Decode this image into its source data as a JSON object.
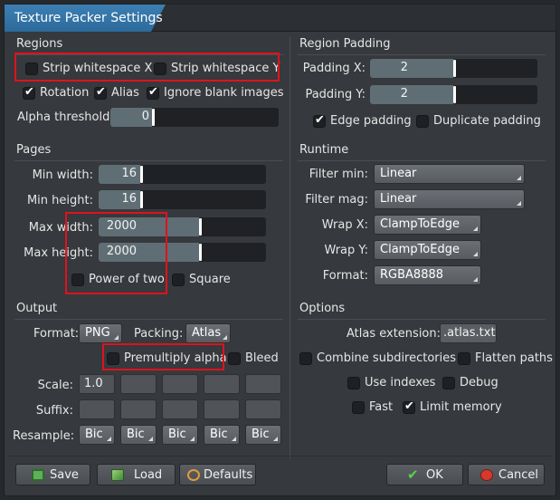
{
  "window": {
    "title": "Texture Packer Settings"
  },
  "regions": {
    "title": "Regions",
    "strip_x": {
      "label": "Strip whitespace X",
      "checked": false
    },
    "strip_y": {
      "label": "Strip whitespace Y",
      "checked": false
    },
    "rotation": {
      "label": "Rotation",
      "checked": true
    },
    "alias": {
      "label": "Alias",
      "checked": true
    },
    "ignore_blank": {
      "label": "Ignore blank images",
      "checked": true
    },
    "alpha_threshold": {
      "label": "Alpha threshold:",
      "value": "0",
      "fraction": 0.0
    }
  },
  "region_padding": {
    "title": "Region Padding",
    "padding_x": {
      "label": "Padding X:",
      "value": "2",
      "fraction": 0.02
    },
    "padding_y": {
      "label": "Padding Y:",
      "value": "2",
      "fraction": 0.02
    },
    "edge_padding": {
      "label": "Edge padding",
      "checked": true
    },
    "duplicate_padding": {
      "label": "Duplicate padding",
      "checked": false
    }
  },
  "pages": {
    "title": "Pages",
    "min_width": {
      "label": "Min width:",
      "value": "16"
    },
    "min_height": {
      "label": "Min height:",
      "value": "16"
    },
    "max_width": {
      "label": "Max width:",
      "value": "2000"
    },
    "max_height": {
      "label": "Max height:",
      "value": "2000"
    },
    "power_of_two": {
      "label": "Power of two",
      "checked": false
    },
    "square": {
      "label": "Square",
      "checked": false
    }
  },
  "runtime": {
    "title": "Runtime",
    "filter_min": {
      "label": "Filter min:",
      "value": "Linear"
    },
    "filter_mag": {
      "label": "Filter mag:",
      "value": "Linear"
    },
    "wrap_x": {
      "label": "Wrap X:",
      "value": "ClampToEdge"
    },
    "wrap_y": {
      "label": "Wrap Y:",
      "value": "ClampToEdge"
    },
    "format": {
      "label": "Format:",
      "value": "RGBA8888"
    }
  },
  "output": {
    "title": "Output",
    "format_label": "Format:",
    "format_value": "PNG",
    "packing_label": "Packing:",
    "packing_value": "Atlas",
    "premultiply_alpha": {
      "label": "Premultiply alpha",
      "checked": false
    },
    "bleed": {
      "label": "Bleed",
      "checked": false
    },
    "scale_label": "Scale:",
    "scale_values": [
      "1.0",
      "",
      "",
      "",
      ""
    ],
    "suffix_label": "Suffix:",
    "suffix_values": [
      "",
      "",
      "",
      "",
      ""
    ],
    "resample_label": "Resample:",
    "resample_values": [
      "Bic",
      "Bic",
      "Bic",
      "Bic",
      "Bic"
    ]
  },
  "options": {
    "title": "Options",
    "atlas_extension_label": "Atlas extension:",
    "atlas_extension_value": ".atlas.txt",
    "combine_subdirectories": {
      "label": "Combine subdirectories",
      "checked": false
    },
    "flatten_paths": {
      "label": "Flatten paths",
      "checked": false
    },
    "use_indexes": {
      "label": "Use indexes",
      "checked": false
    },
    "debug": {
      "label": "Debug",
      "checked": false
    },
    "fast": {
      "label": "Fast",
      "checked": false
    },
    "limit_memory": {
      "label": "Limit memory",
      "checked": true
    }
  },
  "footer": {
    "save": "Save",
    "load": "Load",
    "defaults": "Defaults",
    "ok": "OK",
    "cancel": "Cancel"
  },
  "icons": {
    "check": "✔",
    "save": "floppy-disk-icon",
    "load": "image-icon",
    "defaults": "reset-icon",
    "ok": "checkmark-icon",
    "cancel": "cancel-icon"
  },
  "colors": {
    "accent": "#77b0de",
    "title_tab": "#2c6a9b",
    "highlight_box": "#e0121c",
    "slider_fill": "#5f6e75"
  }
}
